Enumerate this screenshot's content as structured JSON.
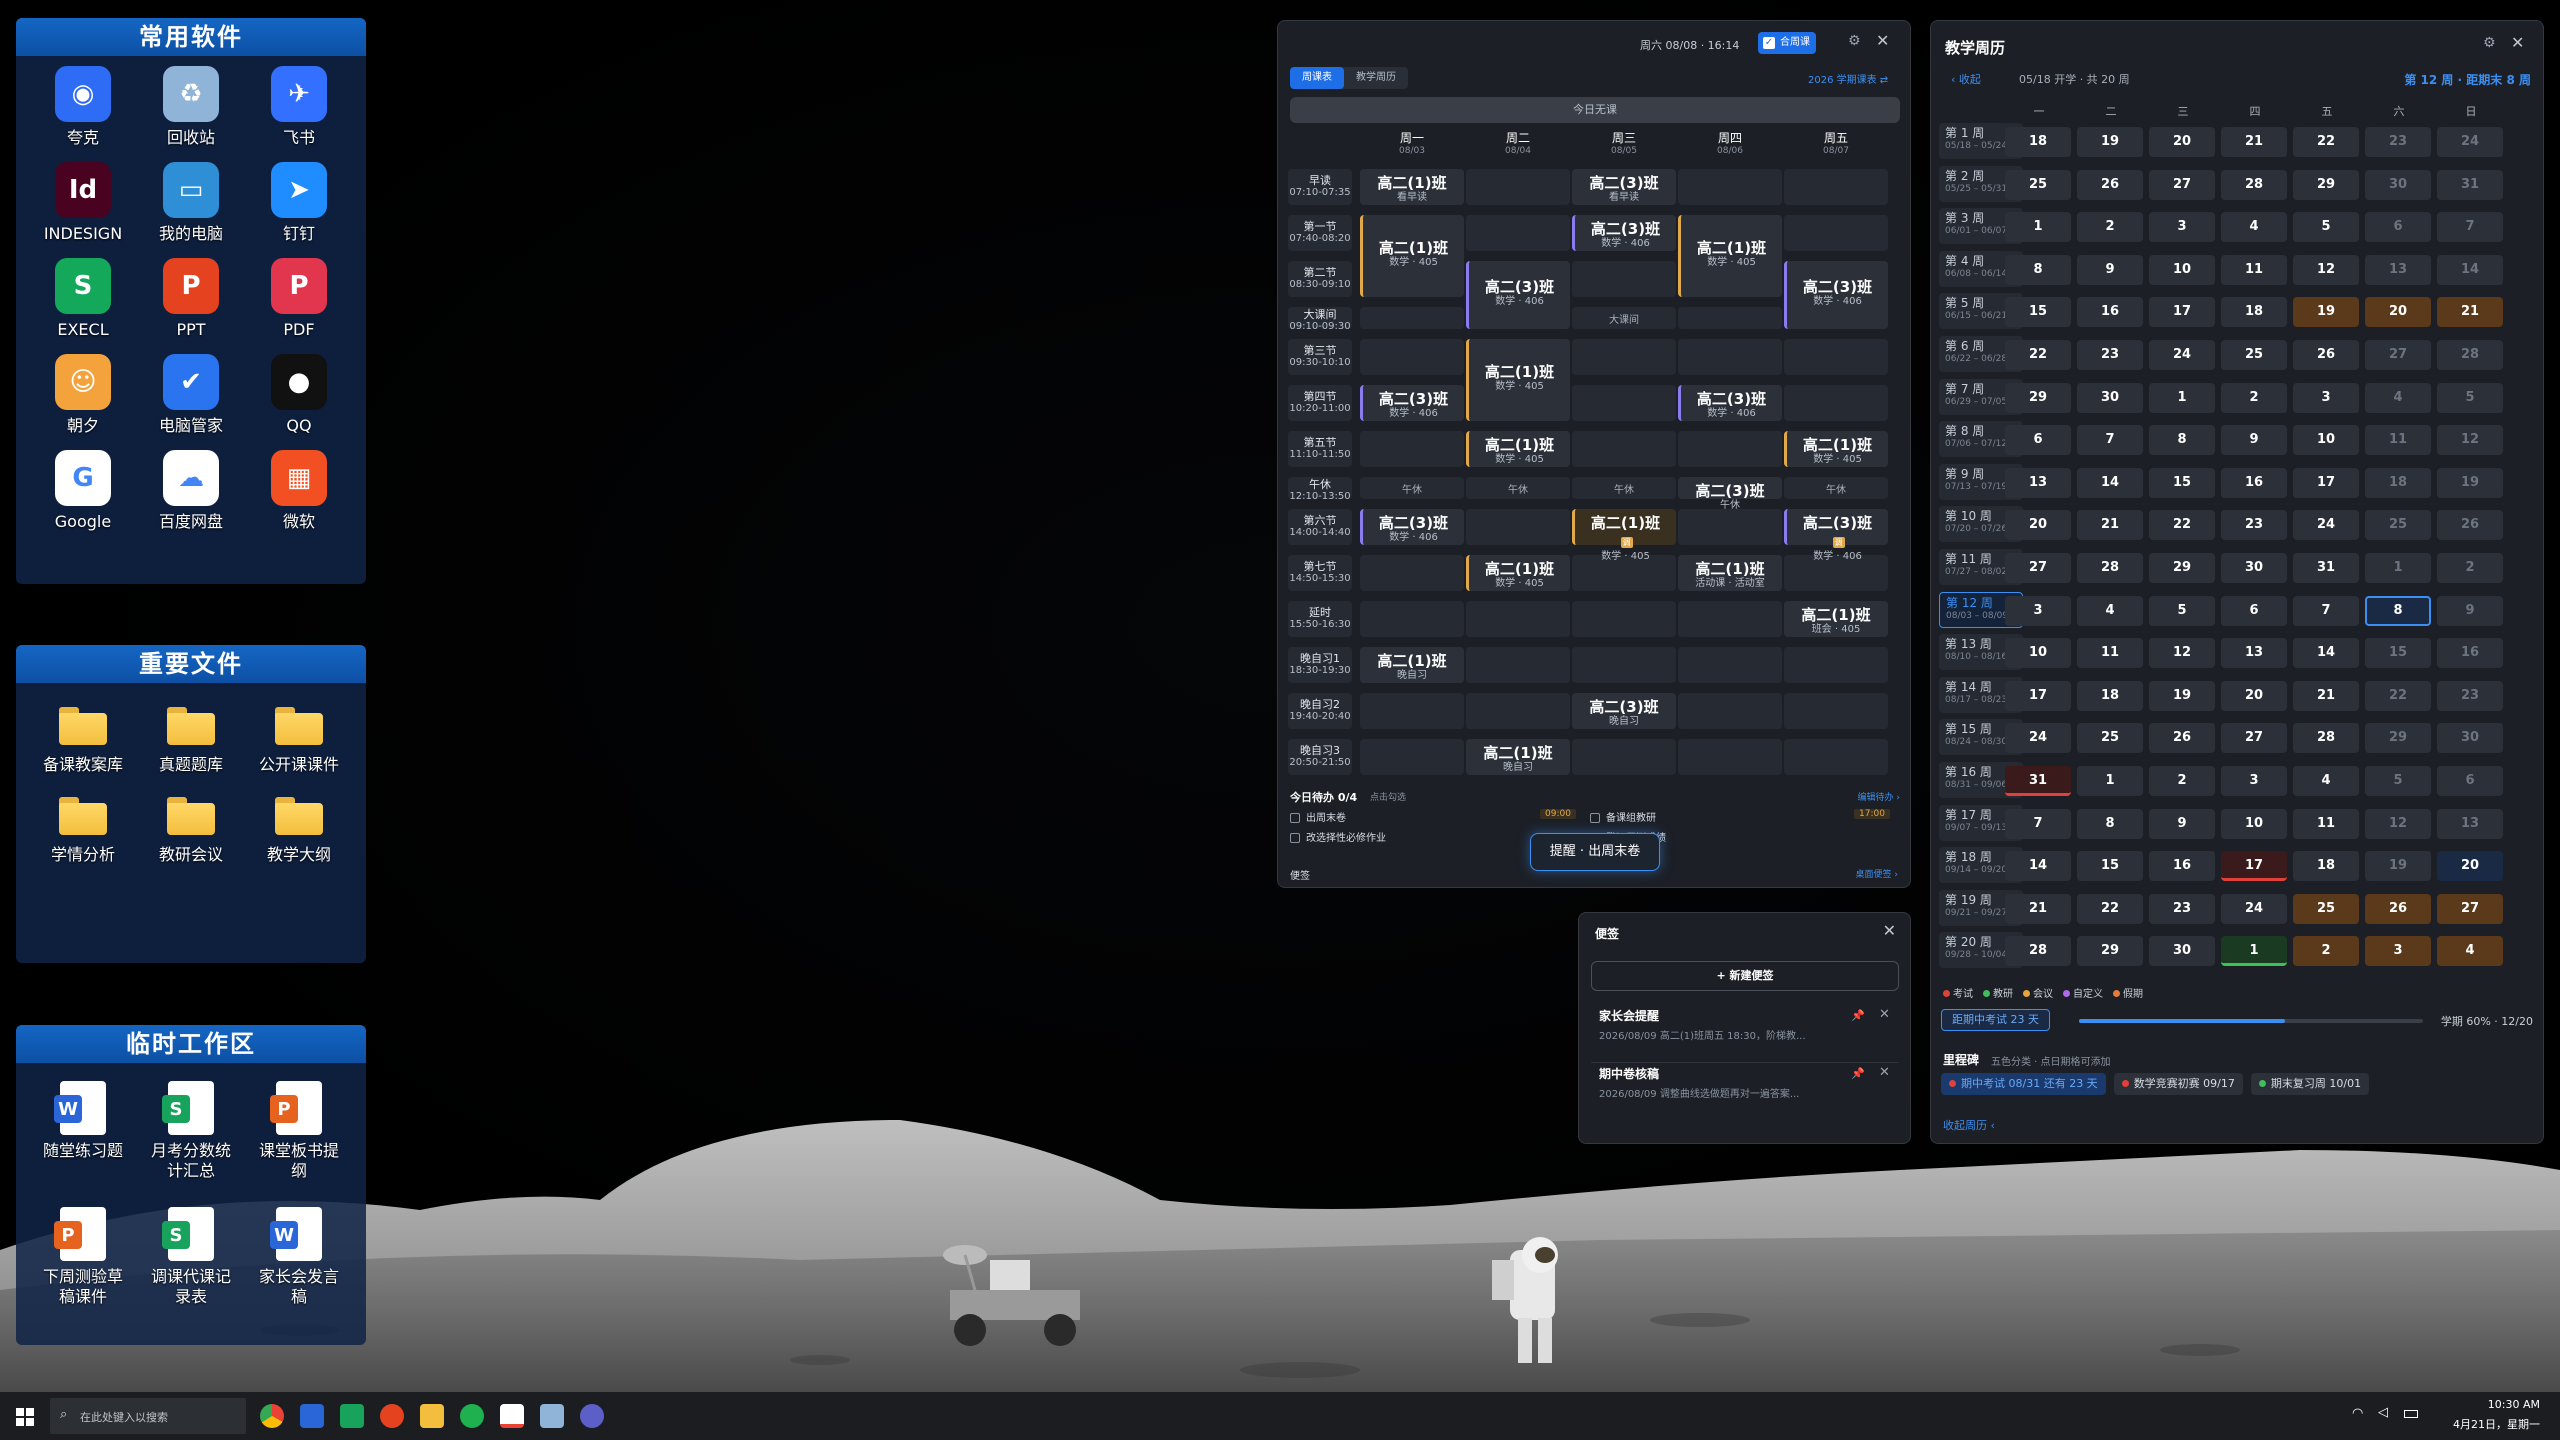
{
  "panels": {
    "common": {
      "title": "常用软件",
      "items": [
        {
          "label": "夸克",
          "icon": "quark-icon",
          "color": "#2f6cf6"
        },
        {
          "label": "回收站",
          "icon": "recycle-bin-icon",
          "color": "#8fb4d8"
        },
        {
          "label": "飞书",
          "icon": "feishu-icon",
          "color": "#3370ff"
        },
        {
          "label": "INDESIGN",
          "icon": "indesign-icon",
          "color": "#49021f"
        },
        {
          "label": "我的电脑",
          "icon": "my-computer-icon",
          "color": "#2e8fd6"
        },
        {
          "label": "钉钉",
          "icon": "dingtalk-icon",
          "color": "#1f8cff"
        },
        {
          "label": "EXECL",
          "icon": "excel-icon",
          "color": "#14a85b"
        },
        {
          "label": "PPT",
          "icon": "ppt-icon",
          "color": "#e5421f"
        },
        {
          "label": "PDF",
          "icon": "pdf-icon",
          "color": "#e2364f"
        },
        {
          "label": "朝夕",
          "icon": "zhaoxi-icon",
          "color": "#f4a33c"
        },
        {
          "label": "电脑管家",
          "icon": "pc-manager-icon",
          "color": "#2a74f0"
        },
        {
          "label": "QQ",
          "icon": "qq-icon",
          "color": "#111"
        },
        {
          "label": "Google",
          "icon": "google-icon",
          "color": "#ffffff"
        },
        {
          "label": "百度网盘",
          "icon": "baidu-netdisk-icon",
          "color": "#ffffff"
        },
        {
          "label": "微软",
          "icon": "microsoft-icon",
          "color": "#f25022"
        }
      ]
    },
    "files": {
      "title": "重要文件",
      "items": [
        {
          "label": "备课教案库"
        },
        {
          "label": "真题题库"
        },
        {
          "label": "公开课课件"
        },
        {
          "label": "学情分析"
        },
        {
          "label": "教研会议"
        },
        {
          "label": "教学大纲"
        }
      ]
    },
    "temp": {
      "title": "临时工作区",
      "items": [
        {
          "label": "随堂练习题",
          "type": "W",
          "color": "#2b66d9"
        },
        {
          "label": "月考分数统计汇总",
          "type": "S",
          "color": "#17a35c"
        },
        {
          "label": "课堂板书提纲",
          "type": "P",
          "color": "#e5621f"
        },
        {
          "label": "下周测验草稿课件",
          "type": "P",
          "color": "#e5621f"
        },
        {
          "label": "调课代课记录表",
          "type": "S",
          "color": "#17a35c"
        },
        {
          "label": "家长会发言稿",
          "type": "W",
          "color": "#2b66d9"
        }
      ]
    }
  },
  "schedule": {
    "date_label": "周六 08/08 · 16:14",
    "adjust_label": "合周课",
    "tabs": [
      "周课表",
      "教学周历"
    ],
    "term_label": "2026 学期课表 ⇄",
    "today_banner": "今日无课",
    "days": [
      {
        "name": "周一",
        "date": "08/03"
      },
      {
        "name": "周二",
        "date": "08/04"
      },
      {
        "name": "周三",
        "date": "08/05"
      },
      {
        "name": "周四",
        "date": "08/06"
      },
      {
        "name": "周五",
        "date": "08/07"
      }
    ],
    "periods": [
      {
        "name": "早读",
        "time": "07:10-07:35"
      },
      {
        "name": "第一节",
        "time": "07:40-08:20"
      },
      {
        "name": "第二节",
        "time": "08:30-09:10"
      },
      {
        "name": "大课间",
        "time": "09:10-09:30"
      },
      {
        "name": "第三节",
        "time": "09:30-10:10"
      },
      {
        "name": "第四节",
        "time": "10:20-11:00"
      },
      {
        "name": "第五节",
        "time": "11:10-11:50"
      },
      {
        "name": "午休",
        "time": "12:10-13:50"
      },
      {
        "name": "第六节",
        "time": "14:00-14:40"
      },
      {
        "name": "第七节",
        "time": "14:50-15:30"
      },
      {
        "name": "延时",
        "time": "15:50-16:30"
      },
      {
        "name": "晚自习1",
        "time": "18:30-19:30"
      },
      {
        "name": "晚自习2",
        "time": "19:40-20:40"
      },
      {
        "name": "晚自习3",
        "time": "20:50-21:50"
      }
    ],
    "classes": [
      {
        "d": 0,
        "p": 0,
        "n": "高二(1)班",
        "r": "看早读",
        "c": "#2b3039",
        "bar": ""
      },
      {
        "d": 2,
        "p": 0,
        "n": "高二(3)班",
        "r": "看早读",
        "c": "#2b3039",
        "bar": ""
      },
      {
        "d": 0,
        "p": 1,
        "span": 2,
        "n": "高二(1)班",
        "r": "数学 · 405",
        "c": "#2b3039",
        "bar": "#e2a94a"
      },
      {
        "d": 2,
        "p": 1,
        "n": "高二(3)班",
        "r": "数学 · 406",
        "c": "#2b3039",
        "bar": "#8a7cf0"
      },
      {
        "d": 3,
        "p": 1,
        "span": 2,
        "n": "高二(1)班",
        "r": "数学 · 405",
        "c": "#2b3039",
        "bar": "#e2a94a"
      },
      {
        "d": 1,
        "p": 2,
        "span": 2,
        "n": "高二(3)班",
        "r": "数学 · 406",
        "c": "#2b3039",
        "bar": "#8a7cf0"
      },
      {
        "d": 4,
        "p": 2,
        "span": 2,
        "n": "高二(3)班",
        "r": "数学 · 406",
        "c": "#2b3039",
        "bar": "#8a7cf0"
      },
      {
        "d": 1,
        "p": 4,
        "span": 2,
        "n": "高二(1)班",
        "r": "数学 · 405",
        "c": "#2b3039",
        "bar": "#e2a94a"
      },
      {
        "d": 0,
        "p": 5,
        "n": "高二(3)班",
        "r": "数学 · 406",
        "c": "#2b3039",
        "bar": "#8a7cf0"
      },
      {
        "d": 3,
        "p": 5,
        "n": "高二(3)班",
        "r": "数学 · 406",
        "c": "#2b3039",
        "bar": "#8a7cf0"
      },
      {
        "d": 1,
        "p": 6,
        "n": "高二(1)班",
        "r": "数学 · 405",
        "c": "#2b3039",
        "bar": "#e2a94a"
      },
      {
        "d": 4,
        "p": 6,
        "n": "高二(1)班",
        "r": "数学 · 405",
        "c": "#2b3039",
        "bar": "#e2a94a"
      },
      {
        "d": 3,
        "p": 7,
        "n": "高二(3)班",
        "r": "午休",
        "c": "#2b3039",
        "bar": ""
      },
      {
        "d": 0,
        "p": 8,
        "n": "高二(3)班",
        "r": "数学 · 406",
        "c": "#2b3039",
        "bar": "#8a7cf0"
      },
      {
        "d": 2,
        "p": 8,
        "n": "高二(1)班",
        "r": "数学 · 405",
        "c": "#3a3020",
        "bar": "#e2a94a",
        "badge": "调"
      },
      {
        "d": 4,
        "p": 8,
        "n": "高二(3)班",
        "r": "数学 · 406",
        "c": "#2b3039",
        "bar": "#8a7cf0",
        "badge": "调"
      },
      {
        "d": 1,
        "p": 9,
        "n": "高二(1)班",
        "r": "数学 · 405",
        "c": "#2b3039",
        "bar": "#e2a94a"
      },
      {
        "d": 3,
        "p": 9,
        "n": "高二(1)班",
        "r": "活动课 · 活动室",
        "c": "#2b3039",
        "bar": ""
      },
      {
        "d": 4,
        "p": 10,
        "n": "高二(1)班",
        "r": "班会 · 405",
        "c": "#2b3039",
        "bar": ""
      },
      {
        "d": 0,
        "p": 11,
        "n": "高二(1)班",
        "r": "晚自习",
        "c": "#2b3039",
        "bar": ""
      },
      {
        "d": 2,
        "p": 12,
        "n": "高二(3)班",
        "r": "晚自习",
        "c": "#2b3039",
        "bar": ""
      },
      {
        "d": 1,
        "p": 13,
        "n": "高二(1)班",
        "r": "晚自习",
        "c": "#2b3039",
        "bar": ""
      }
    ],
    "break_labels": {
      "big": "大课间",
      "noon": "午休"
    },
    "todo_title": "今日待办 0/4",
    "todo_hint": "点击勾选",
    "todo_edit": "编辑待办 ›",
    "todos": [
      {
        "label": "出周末卷",
        "time": "09:00"
      },
      {
        "label": "改选择性必修作业",
        "time": ""
      },
      {
        "label": "备课组教研",
        "time": "17:00"
      },
      {
        "label": "登记周测成绩",
        "time": ""
      }
    ],
    "toast": "提醒 · 出周末卷",
    "notes_label": "便签",
    "notes_link": "桌面便签 ›"
  },
  "notes": {
    "title": "便签",
    "new_button": "+ 新建便签",
    "items": [
      {
        "title": "家长会提醒",
        "text": "2026/08/09 高二(1)班周五 18:30，阶梯教..."
      },
      {
        "title": "期中卷核稿",
        "text": "2026/08/09 调整曲线选做题再对一遍答案..."
      }
    ]
  },
  "calendar": {
    "title": "教学周历",
    "collapse": "‹ 收起",
    "start_info": "05/18 开学 · 共 20 周",
    "current_info": "第 12 周 · 距期末 8 周",
    "weekdays": [
      "一",
      "二",
      "三",
      "四",
      "五",
      "六",
      "日"
    ],
    "weeks": [
      {
        "w": "第 1 周",
        "r": "05/18 – 05/24",
        "d": [
          "18",
          "19",
          "20",
          "21",
          "22",
          "23",
          "24"
        ]
      },
      {
        "w": "第 2 周",
        "r": "05/25 – 05/31",
        "d": [
          "25",
          "26",
          "27",
          "28",
          "29",
          "30",
          "31"
        ]
      },
      {
        "w": "第 3 周",
        "r": "06/01 – 06/07",
        "d": [
          "1",
          "2",
          "3",
          "4",
          "5",
          "6",
          "7"
        ]
      },
      {
        "w": "第 4 周",
        "r": "06/08 – 06/14",
        "d": [
          "8",
          "9",
          "10",
          "11",
          "12",
          "13",
          "14"
        ]
      },
      {
        "w": "第 5 周",
        "r": "06/15 – 06/21",
        "d": [
          "15",
          "16",
          "17",
          "18",
          "19",
          "20",
          "21"
        ]
      },
      {
        "w": "第 6 周",
        "r": "06/22 – 06/28",
        "d": [
          "22",
          "23",
          "24",
          "25",
          "26",
          "27",
          "28"
        ]
      },
      {
        "w": "第 7 周",
        "r": "06/29 – 07/05",
        "d": [
          "29",
          "30",
          "1",
          "2",
          "3",
          "4",
          "5"
        ]
      },
      {
        "w": "第 8 周",
        "r": "07/06 – 07/12",
        "d": [
          "6",
          "7",
          "8",
          "9",
          "10",
          "11",
          "12"
        ]
      },
      {
        "w": "第 9 周",
        "r": "07/13 – 07/19",
        "d": [
          "13",
          "14",
          "15",
          "16",
          "17",
          "18",
          "19"
        ]
      },
      {
        "w": "第 10 周",
        "r": "07/20 – 07/26",
        "d": [
          "20",
          "21",
          "22",
          "23",
          "24",
          "25",
          "26"
        ]
      },
      {
        "w": "第 11 周",
        "r": "07/27 – 08/02",
        "d": [
          "27",
          "28",
          "29",
          "30",
          "31",
          "1",
          "2"
        ]
      },
      {
        "w": "第 12 周",
        "r": "08/03 – 08/09",
        "d": [
          "3",
          "4",
          "5",
          "6",
          "7",
          "8",
          "9"
        ]
      },
      {
        "w": "第 13 周",
        "r": "08/10 – 08/16",
        "d": [
          "10",
          "11",
          "12",
          "13",
          "14",
          "15",
          "16"
        ]
      },
      {
        "w": "第 14 周",
        "r": "08/17 – 08/23",
        "d": [
          "17",
          "18",
          "19",
          "20",
          "21",
          "22",
          "23"
        ]
      },
      {
        "w": "第 15 周",
        "r": "08/24 – 08/30",
        "d": [
          "24",
          "25",
          "26",
          "27",
          "28",
          "29",
          "30"
        ]
      },
      {
        "w": "第 16 周",
        "r": "08/31 – 09/06",
        "d": [
          "31",
          "1",
          "2",
          "3",
          "4",
          "5",
          "6"
        ]
      },
      {
        "w": "第 17 周",
        "r": "09/07 – 09/13",
        "d": [
          "7",
          "8",
          "9",
          "10",
          "11",
          "12",
          "13"
        ]
      },
      {
        "w": "第 18 周",
        "r": "09/14 – 09/20",
        "d": [
          "14",
          "15",
          "16",
          "17",
          "18",
          "19",
          "20"
        ]
      },
      {
        "w": "第 19 周",
        "r": "09/21 – 09/27",
        "d": [
          "21",
          "22",
          "23",
          "24",
          "25",
          "26",
          "27"
        ]
      },
      {
        "w": "第 20 周",
        "r": "09/28 – 10/04",
        "d": [
          "28",
          "29",
          "30",
          "1",
          "2",
          "3",
          "4"
        ]
      }
    ],
    "legend": [
      {
        "label": "考试",
        "color": "#e0413a"
      },
      {
        "label": "教研",
        "color": "#3fbf5a"
      },
      {
        "label": "会议",
        "color": "#e8a63a"
      },
      {
        "label": "自定义",
        "color": "#b06ae8"
      },
      {
        "label": "假期",
        "color": "#e87a3a"
      }
    ],
    "countdown": "距期中考试 23 天",
    "progress_label": "学期 60% · 12/20",
    "progress": 0.6,
    "milestone_title": "里程碑",
    "milestone_hint": "五色分类 · 点日期格可添加",
    "milestones": [
      {
        "label": "期中考试 08/31 还有 23 天",
        "color": "#e0413a"
      },
      {
        "label": "数学竞赛初赛 09/17",
        "color": "#e0413a"
      },
      {
        "label": "期末复习周 10/01",
        "color": "#3fbf5a"
      }
    ],
    "footer": "收起周历 ‹"
  },
  "taskbar": {
    "search_placeholder": "在此处键入以搜索",
    "time": "10:30 AM",
    "date": "4月21日，星期一"
  }
}
